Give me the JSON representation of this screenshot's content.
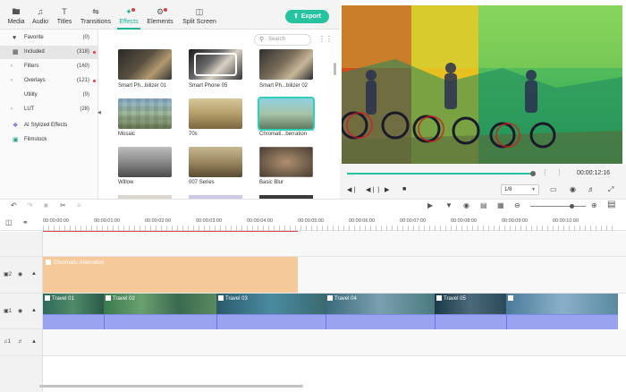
{
  "toolbar": {
    "tabs": [
      {
        "label": "Media",
        "icon": "folder-icon"
      },
      {
        "label": "Audio",
        "icon": "music-note-icon"
      },
      {
        "label": "Titles",
        "icon": "text-icon"
      },
      {
        "label": "Transitions",
        "icon": "transition-icon"
      },
      {
        "label": "Effects",
        "icon": "effects-icon",
        "active": true
      },
      {
        "label": "Elements",
        "icon": "elements-icon"
      },
      {
        "label": "Split Screen",
        "icon": "split-screen-icon"
      }
    ],
    "export_label": "Export"
  },
  "categories": [
    {
      "label": "Favorite",
      "count": "(0)",
      "icon": "heart-icon"
    },
    {
      "label": "Included",
      "count": "(318)",
      "icon": "grid-icon",
      "selected": true,
      "dot": true
    },
    {
      "label": "Filters",
      "count": "(160)",
      "expandable": true
    },
    {
      "label": "Overlays",
      "count": "(121)",
      "expandable": true,
      "dot": true
    },
    {
      "label": "Utility",
      "count": "(9)"
    },
    {
      "label": "LUT",
      "count": "(28)",
      "expandable": true
    },
    {
      "label": "AI Stylized Effects",
      "count": "",
      "icon": "ai-icon"
    },
    {
      "label": "Filmstock",
      "count": "",
      "icon": "film-icon"
    }
  ],
  "search": {
    "placeholder": "Search"
  },
  "effects": [
    {
      "label": "Smart Ph...bilizer 01"
    },
    {
      "label": "Smart Phone 05"
    },
    {
      "label": "Smart Ph...bilizer 02"
    },
    {
      "label": "Mosaic"
    },
    {
      "label": "70s"
    },
    {
      "label": "Chromati...berration",
      "selected": true
    },
    {
      "label": "Willow"
    },
    {
      "label": "007 Series"
    },
    {
      "label": "Basic Blur"
    }
  ],
  "player": {
    "timecode": "00:00:12:16",
    "ratio": "1/8",
    "progress_fraction": 0.99
  },
  "ruler": {
    "labels": [
      "00:00:00:00",
      "00:00:01:00",
      "00:00:02:00",
      "00:00:03:00",
      "00:00:04:00",
      "00:00:05:00",
      "00:00:06:00",
      "00:00:07:00",
      "00:00:08:00",
      "00:00:09:00",
      "00:00:10:00"
    ]
  },
  "tracks": {
    "effect_track_label": "2",
    "video_track_label": "1",
    "audio_track_label": "1",
    "effect_clip_label": "Chromatic Aberration",
    "video_clips": [
      "Travel 01",
      "Travel 02",
      "Travel 03",
      "Travel 04",
      "Travel 05",
      ""
    ]
  },
  "colors": {
    "accent": "#27c2a0",
    "effect_clip": "#f5c99a",
    "audio": "#9aa3ef",
    "playhead": "#e24040"
  }
}
